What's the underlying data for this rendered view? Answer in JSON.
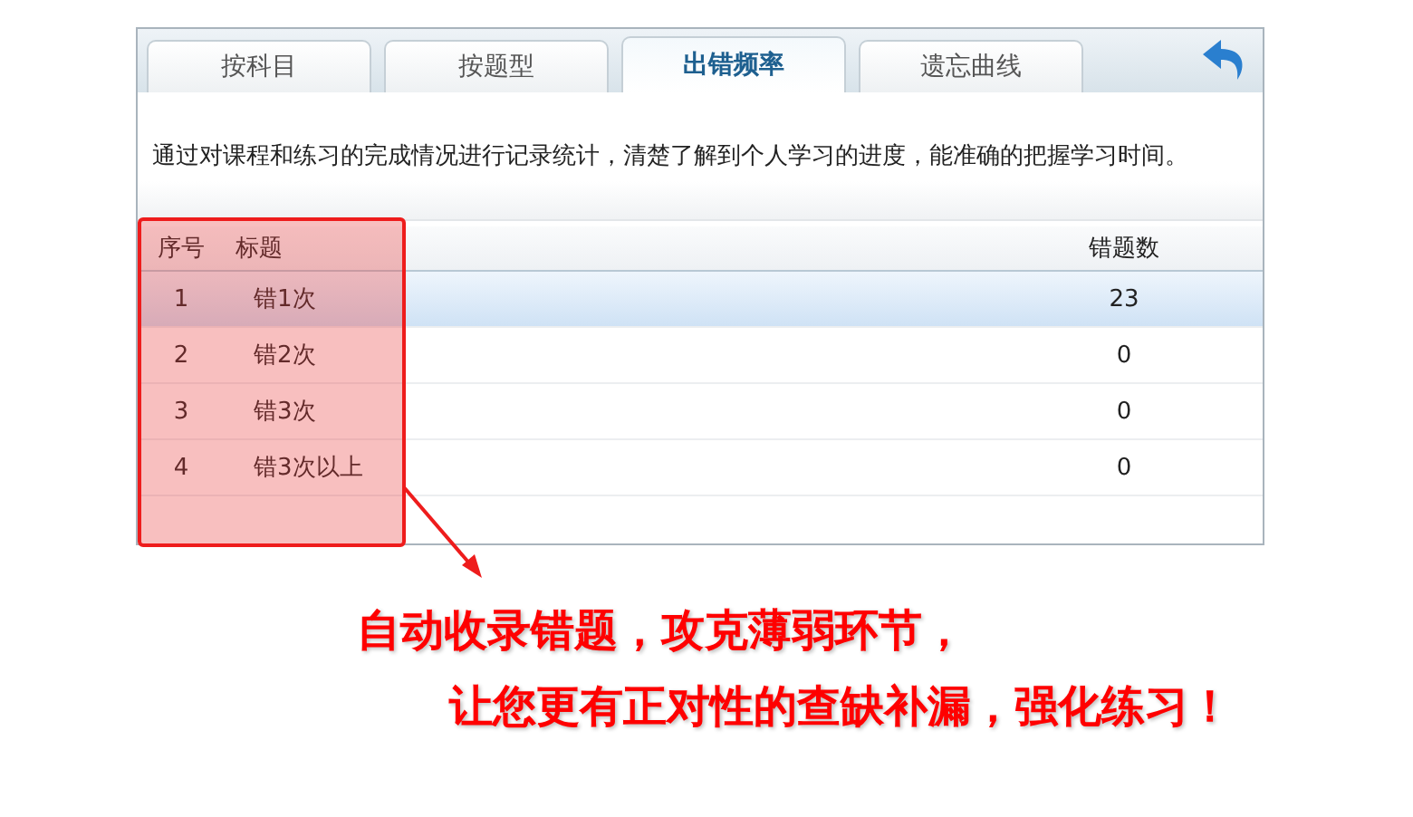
{
  "tabs": [
    {
      "label": "按科目",
      "selected": false
    },
    {
      "label": "按题型",
      "selected": false
    },
    {
      "label": "出错频率",
      "selected": true
    },
    {
      "label": "遗忘曲线",
      "selected": false
    }
  ],
  "description": "通过对课程和练习的完成情况进行记录统计，清楚了解到个人学习的进度，能准确的把握学习时间。",
  "table": {
    "columns": [
      "序号",
      "标题",
      "错题数"
    ],
    "rows": [
      {
        "cells": [
          "1",
          "错1次",
          "23"
        ],
        "selected": true
      },
      {
        "cells": [
          "2",
          "错2次",
          "0"
        ],
        "selected": false
      },
      {
        "cells": [
          "3",
          "错3次",
          "0"
        ],
        "selected": false
      },
      {
        "cells": [
          "4",
          "错3次以上",
          "0"
        ],
        "selected": false
      }
    ]
  },
  "callout": {
    "lines": [
      "自动收录错题，攻克薄弱环节，",
      "让您更有正对性的查缺补漏，强化练习！"
    ]
  }
}
